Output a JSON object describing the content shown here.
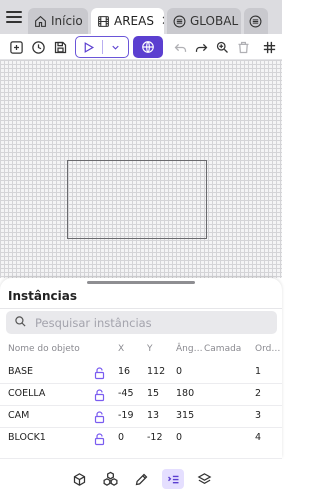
{
  "tabs": [
    {
      "label": "Início",
      "icon": "home-icon",
      "active": false
    },
    {
      "label": "AREAS",
      "icon": "film-icon",
      "active": true
    },
    {
      "label": "GLOBAL",
      "icon": "stack-icon",
      "active": false
    },
    {
      "label": "",
      "icon": "stack-icon",
      "active": false
    }
  ],
  "toolbar": {
    "icons": [
      "add-box-icon",
      "history-icon",
      "save-icon",
      "play-icon",
      "chevron-down-icon",
      "globe-icon",
      "undo-icon",
      "redo-icon",
      "zoom-in-icon",
      "delete-icon",
      "grid-icon"
    ],
    "accent": "#5b3fd0"
  },
  "sheet": {
    "title": "Instâncias",
    "search_placeholder": "Pesquisar instâncias",
    "columns": {
      "name": "Nome do objeto",
      "x": "X",
      "y": "Y",
      "angle": "Âng…",
      "layer": "Camada",
      "order": "Ord…"
    },
    "rows": [
      {
        "name": "BASE",
        "x": "16",
        "y": "112",
        "angle": "0",
        "layer": "",
        "order": "1"
      },
      {
        "name": "COELLA",
        "x": "-45",
        "y": "15",
        "angle": "180",
        "layer": "",
        "order": "2"
      },
      {
        "name": "CAM",
        "x": "-19",
        "y": "13",
        "angle": "315",
        "layer": "",
        "order": "3"
      },
      {
        "name": "BLOCK1",
        "x": "0",
        "y": "-12",
        "angle": "0",
        "layer": "",
        "order": "4"
      }
    ]
  },
  "bottom_nav": {
    "items": [
      "cube-icon",
      "cubes-icon",
      "pencil-icon",
      "list-icon",
      "layers-icon"
    ],
    "active": "list-icon"
  }
}
